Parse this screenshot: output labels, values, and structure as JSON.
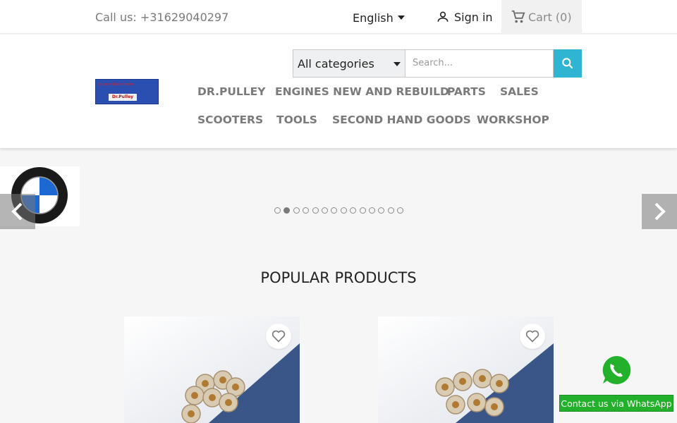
{
  "topbar": {
    "call_text": "Call us: +31629040297",
    "language": "English",
    "signin_label": "Sign in",
    "cart_label": "Cart",
    "cart_count": "(0)"
  },
  "header": {
    "logo_alt": "Dr.Pulley",
    "logo_line1": "Scooter Onderdelen",
    "logo_line2": "Dr.Pulley",
    "category_select": "All categories",
    "search_placeholder": "Search...",
    "nav": [
      "DR.PULLEY",
      "ENGINES NEW AND REBUILD",
      "PARTS",
      "SALES",
      "SCOOTERS",
      "TOOLS",
      "SECOND HAND GOODS",
      "WORKSHOP"
    ]
  },
  "slider": {
    "brand": "BMW",
    "dot_count": 14,
    "active_dot": 2
  },
  "popular": {
    "title": "POPULAR PRODUCTS"
  },
  "whatsapp": {
    "label": "Contact us via WhatsApp"
  },
  "colors": {
    "accent": "#2fb5d2",
    "whatsapp": "#23b12b"
  }
}
